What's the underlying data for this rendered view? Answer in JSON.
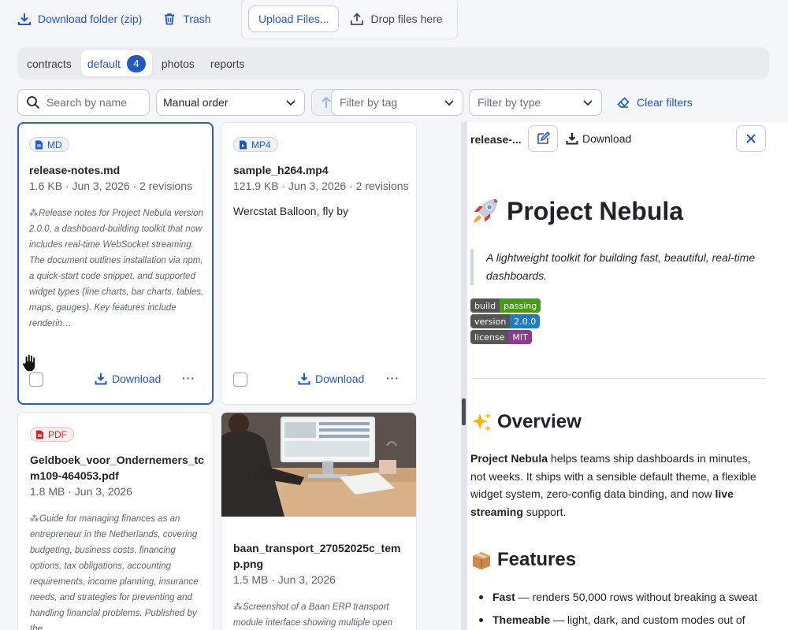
{
  "toolbar": {
    "download_folder": "Download folder (zip)",
    "trash": "Trash",
    "upload_files": "Upload Files...",
    "drop_files": "Drop files here"
  },
  "tabs": [
    {
      "label": "contracts",
      "active": false
    },
    {
      "label": "default",
      "active": true,
      "count": "4"
    },
    {
      "label": "photos",
      "active": false
    },
    {
      "label": "reports",
      "active": false
    }
  ],
  "filters": {
    "search_placeholder": "Search by name",
    "order_value": "Manual order",
    "tag_placeholder": "Filter by tag",
    "type_placeholder": "Filter by type",
    "clear_label": "Clear filters"
  },
  "cards": [
    {
      "type": "MD",
      "name": "release-notes.md",
      "meta": "1.6 KB · Jun 3, 2026 · 2 revisions",
      "summary": "Release notes for Project Nebula version 2.0.0, a dashboard-building toolkit that now includes real-time WebSocket streaming. The document outlines installation via npm, a quick-start code snippet, and supported widget types (line charts, bar charts, tables, maps, gauges). Key features include renderin…",
      "download": "Download",
      "more": "···"
    },
    {
      "type": "MP4",
      "name": "sample_h264.mp4",
      "meta": "121.9 KB · Jun 3, 2026 · 2 revisions",
      "content": "Wercstat Balloon, fly by",
      "download": "Download",
      "more": "···"
    },
    {
      "type": "PDF",
      "name": "Geldboek_voor_Ondernemers_tcm109-464053.pdf",
      "meta": "1.8 MB · Jun 3, 2026",
      "summary": "Guide for managing finances as an entrepreneur in the Netherlands, covering budgeting, business costs, financing options, tax obligations, accounting requirements, income planning, insurance needs, and strategies for preventing and handling financial problems. Published by the"
    },
    {
      "type": "PNG",
      "name": "baan_transport_27052025c_temp.png",
      "meta": "1.5 MB · Jun 3, 2026",
      "summary": "Screenshot of a Baan ERP transport module interface showing multiple open"
    }
  ],
  "preview": {
    "title": "release-...",
    "download": "Download",
    "h1": "Project Nebula",
    "h1_emoji": "rocket",
    "tagline": "A lightweight toolkit for building fast, beautiful, real-time dashboards.",
    "badges": [
      {
        "label": "build",
        "value": "passing",
        "color": "#4c9a1a"
      },
      {
        "label": "version",
        "value": "2.0.0",
        "color": "#1f7bc2"
      },
      {
        "label": "license",
        "value": "MIT",
        "color": "#8b3a8c"
      }
    ],
    "overview_heading": "Overview",
    "overview_emoji": "sparkles",
    "overview_bold1": "Project Nebula",
    "overview_text1": " helps teams ship dashboards in minutes, not weeks. It ships with a sensible default theme, a flexible widget system, zero-config data binding, and now ",
    "overview_bold2": "live streaming",
    "overview_text2": " support.",
    "features_heading": "Features",
    "features_emoji": "package",
    "features": [
      {
        "bold": "Fast",
        "text": " — renders 50,000 rows without breaking a sweat"
      },
      {
        "bold": "Themeable",
        "text": " — light, dark, and custom modes out of"
      }
    ]
  }
}
